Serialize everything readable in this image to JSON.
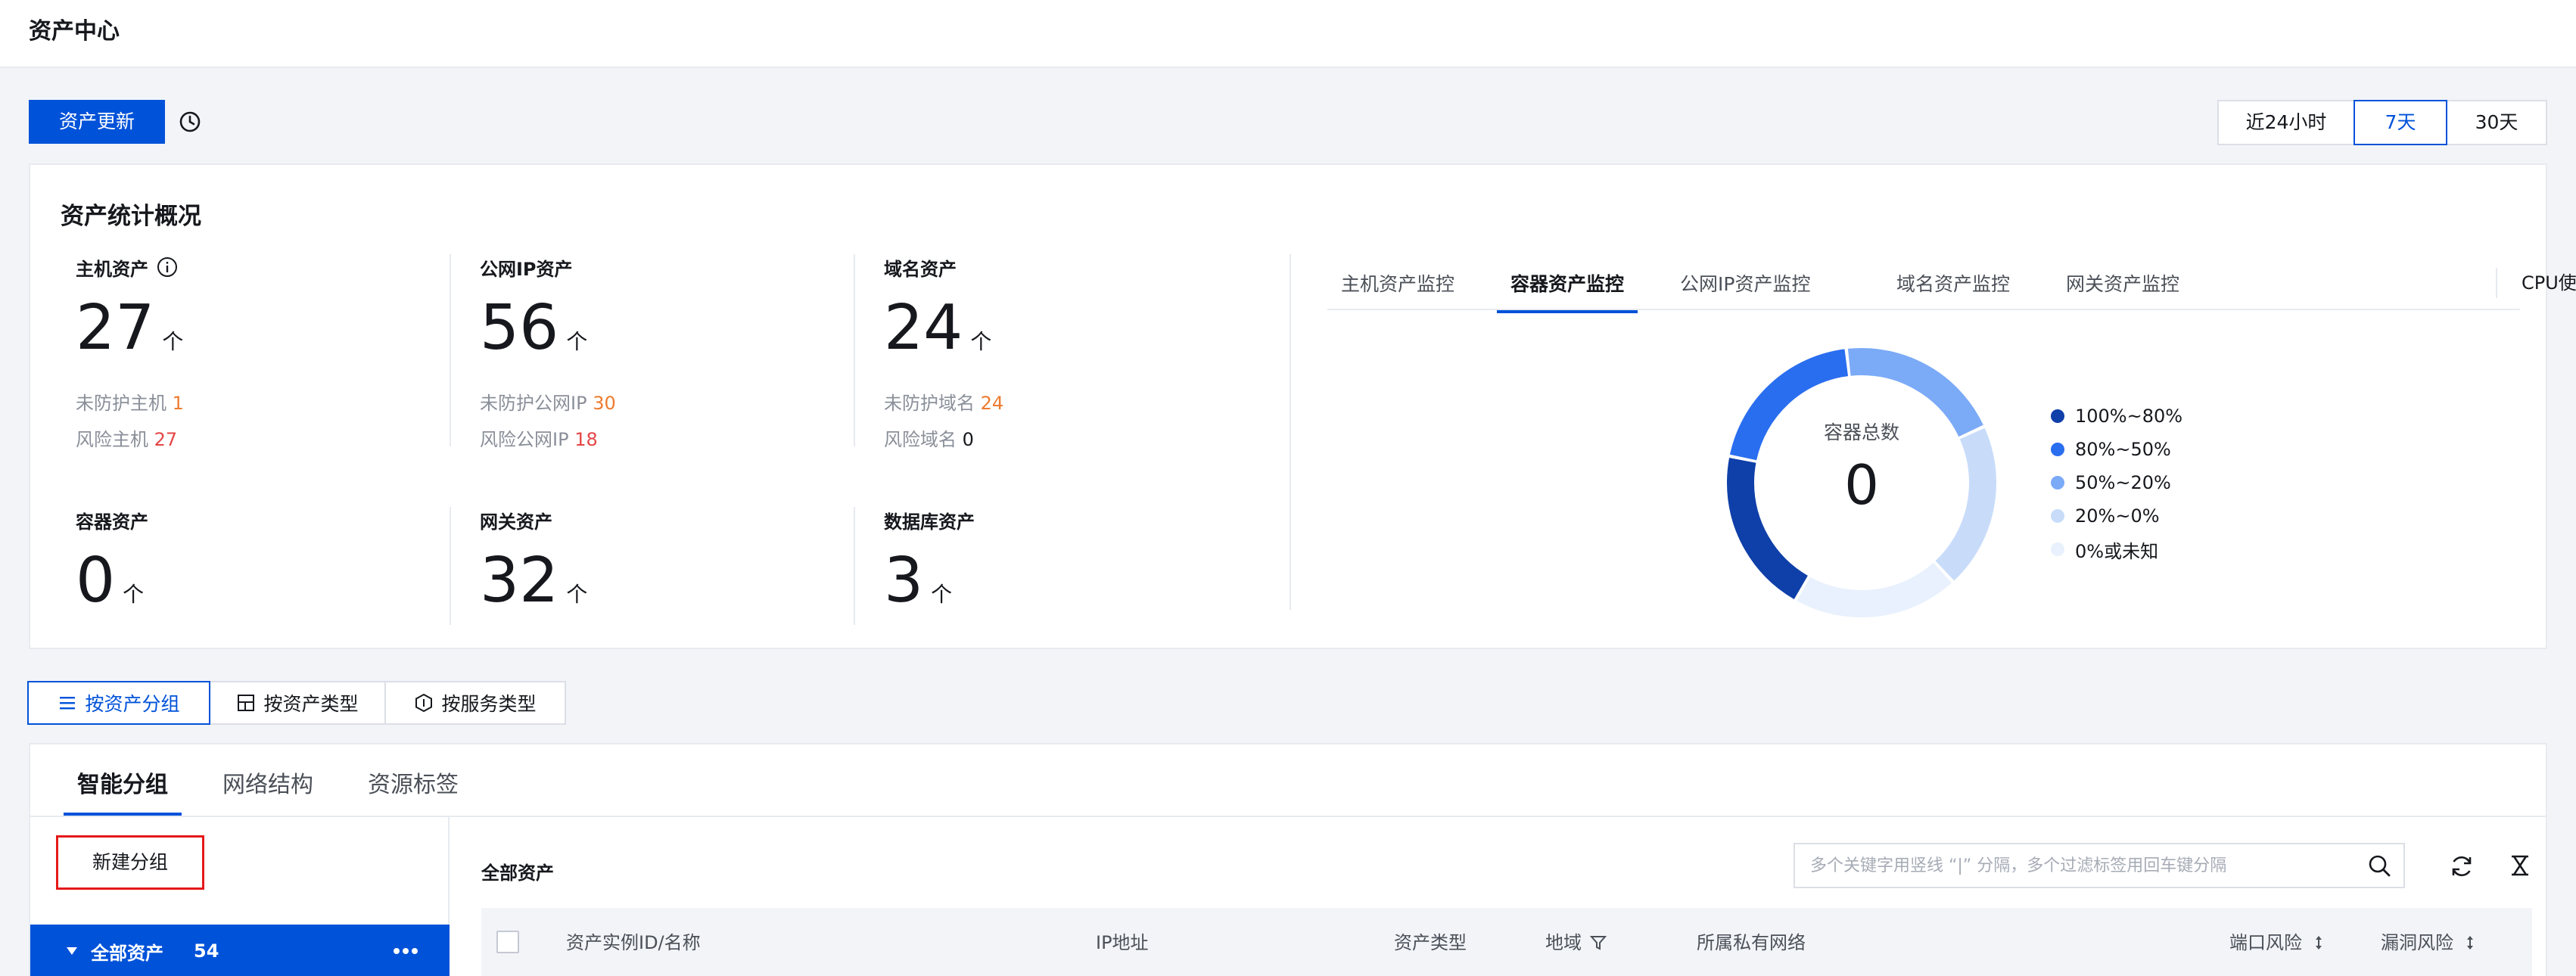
{
  "page": {
    "title": "资产中心"
  },
  "toolbar": {
    "update_label": "资产更新",
    "time_range": [
      "近24小时",
      "7天",
      "30天"
    ],
    "active_range": "7天"
  },
  "overview": {
    "title": "资产统计概况",
    "host": {
      "label": "主机资产",
      "value": "27",
      "unit": "个",
      "sub1_label": "未防护主机",
      "sub1_value": "1",
      "sub2_label": "风险主机",
      "sub2_value": "27"
    },
    "public_ip": {
      "label": "公网IP资产",
      "value": "56",
      "unit": "个",
      "sub1_label": "未防护公网IP",
      "sub1_value": "30",
      "sub2_label": "风险公网IP",
      "sub2_value": "18"
    },
    "domain": {
      "label": "域名资产",
      "value": "24",
      "unit": "个",
      "sub1_label": "未防护域名",
      "sub1_value": "24",
      "sub2_label": "风险域名",
      "sub2_value": "0"
    },
    "container": {
      "label": "容器资产",
      "value": "0",
      "unit": "个"
    },
    "gateway": {
      "label": "网关资产",
      "value": "32",
      "unit": "个"
    },
    "database": {
      "label": "数据库资产",
      "value": "3",
      "unit": "个"
    }
  },
  "monitor": {
    "tabs": [
      "主机资产监控",
      "容器资产监控",
      "公网IP资产监控",
      "域名资产监控",
      "网关资产监控"
    ],
    "active_tab": "容器资产监控",
    "metric": "CPU使用率",
    "donut_title": "容器总数",
    "donut_value": "0",
    "legend": [
      {
        "label": "100%~80%",
        "color": "#0f3fa8"
      },
      {
        "label": "80%~50%",
        "color": "#2a6ef0"
      },
      {
        "label": "50%~20%",
        "color": "#7baaf7"
      },
      {
        "label": "20%~0%",
        "color": "#c8dcfa"
      },
      {
        "label": "0%或未知",
        "color": "#e8f1fd"
      }
    ]
  },
  "view_tabs": [
    "按资产分组",
    "按资产类型",
    "按服务类型"
  ],
  "group_tabs": [
    "智能分组",
    "网络结构",
    "资源标签"
  ],
  "left_panel": {
    "new_group": "新建分组",
    "all_assets": "全部资产",
    "all_count": "54"
  },
  "table": {
    "title": "全部资产",
    "search_placeholder": "多个关键字用竖线 “|” 分隔，多个过滤标签用回车键分隔",
    "columns": [
      "资产实例ID/名称",
      "IP地址",
      "资产类型",
      "地域",
      "所属私有网络",
      "端口风险",
      "漏洞风险"
    ]
  }
}
